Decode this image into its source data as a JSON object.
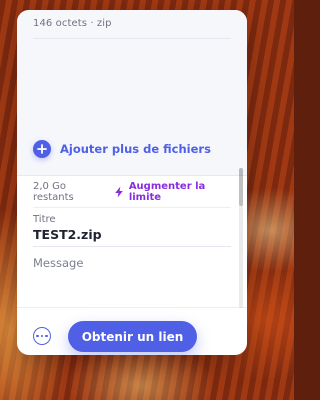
{
  "colors": {
    "accent": "#4f60e6",
    "accent_secondary": "#8a2be2",
    "text_primary": "#1f2230",
    "text_muted": "#6f7285",
    "card_bg": "#ffffff",
    "panel_bg": "#f6f7fb"
  },
  "file": {
    "meta": "146 octets · zip"
  },
  "actions": {
    "add_more_files_label": "Ajouter plus de fichiers",
    "add_icon": "plus-icon"
  },
  "quota": {
    "remaining": "2,0 Go restants",
    "upgrade_label": "Augmenter la limite",
    "upgrade_icon": "lightning-bolt-icon"
  },
  "form": {
    "title_label": "Titre",
    "title_value": "TEST2.zip",
    "message_placeholder": "Message"
  },
  "footer": {
    "more_icon": "more-options-icon",
    "primary_button_label": "Obtenir un lien"
  }
}
